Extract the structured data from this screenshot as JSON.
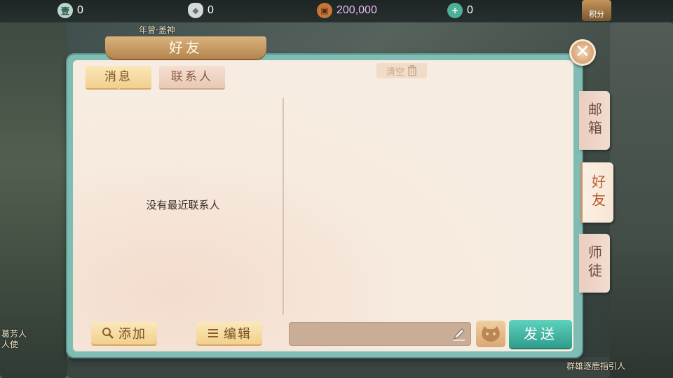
{
  "topbar": {
    "resources": [
      {
        "icon": "jade-token-icon",
        "value": "0"
      },
      {
        "icon": "silver-ingot-icon",
        "value": "0"
      },
      {
        "icon": "copper-coin-icon",
        "value": "200,000"
      },
      {
        "icon": "add-jade-icon",
        "value": "0"
      }
    ],
    "score_label": "积分"
  },
  "background": {
    "npc_label_top": "年曾·盖神",
    "npc_label_left": "葛芳人\n人使",
    "npc_label_right": "群雄逐鹿指引人"
  },
  "panel": {
    "title": "好友",
    "tabs": {
      "messages": "消息",
      "contacts": "联系人"
    },
    "empty_text": "没有最近联系人",
    "clear_label": "清空",
    "add_label": "添加",
    "edit_label": "编辑",
    "send_label": "发送",
    "input_value": ""
  },
  "side_tabs": {
    "mail": "邮箱",
    "friends": "好友",
    "master": "师徒"
  },
  "colors": {
    "panel_border": "#7fbcb3",
    "send_button": "#3fb6a2",
    "accent_gold": "#f1cf8e"
  }
}
